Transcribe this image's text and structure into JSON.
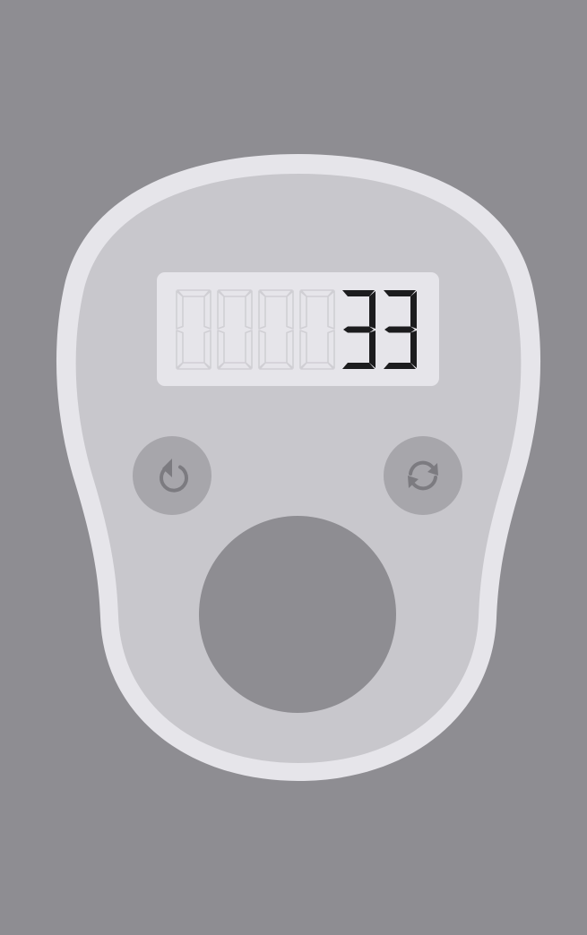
{
  "counter": {
    "value": "33",
    "digit_count": 6,
    "colors": {
      "background": "#8e8d92",
      "body_rim": "#e6e5ea",
      "body_face": "#c8c7cc",
      "display_background": "#e6e5ea",
      "digit_active": "#1c1c1e",
      "digit_inactive": "#d0cfd4",
      "button_fill": "#a7a6ab",
      "button_icon": "#7c7b80",
      "count_button_fill": "#8e8d92"
    }
  },
  "controls": {
    "undo_icon": "undo-arrow-icon",
    "reset_icon": "refresh-arrows-icon"
  }
}
